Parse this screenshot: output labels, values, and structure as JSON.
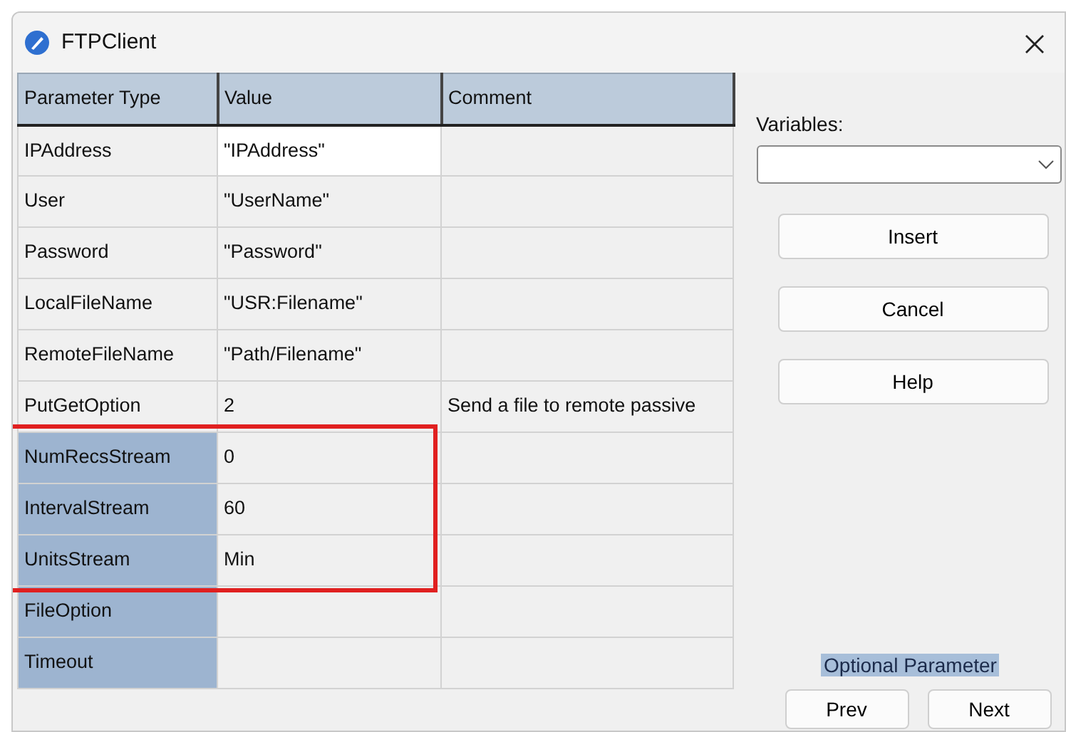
{
  "window": {
    "title": "FTPClient"
  },
  "table": {
    "columns": [
      "Parameter Type",
      "Value",
      "Comment"
    ],
    "rows": [
      {
        "parameter": "IPAddress",
        "value": "\"IPAddress\"",
        "optional": false,
        "editing": true,
        "highlighted": false
      },
      {
        "parameter": "User",
        "value": "\"UserName\"",
        "optional": false,
        "editing": false,
        "highlighted": false
      },
      {
        "parameter": "Password",
        "value": "\"Password\"",
        "optional": false,
        "editing": false,
        "highlighted": false
      },
      {
        "parameter": "LocalFileName",
        "value": "\"USR:Filename\"",
        "optional": false,
        "editing": false,
        "highlighted": false
      },
      {
        "parameter": "RemoteFileName",
        "value": "\"Path/Filename\"",
        "optional": false,
        "editing": false,
        "highlighted": false
      },
      {
        "parameter": "PutGetOption",
        "value": "2",
        "comment": "Send a file to remote passive",
        "optional": false,
        "editing": false,
        "highlighted": false
      },
      {
        "parameter": "NumRecsStream",
        "value": "0",
        "optional": true,
        "editing": false,
        "highlighted": true
      },
      {
        "parameter": "IntervalStream",
        "value": "60",
        "optional": true,
        "editing": false,
        "highlighted": true
      },
      {
        "parameter": "UnitsStream",
        "value": "Min",
        "optional": true,
        "editing": false,
        "highlighted": true
      },
      {
        "parameter": "FileOption",
        "optional": true,
        "editing": false,
        "highlighted": false
      },
      {
        "parameter": "Timeout",
        "optional": true,
        "editing": false,
        "highlighted": false
      }
    ]
  },
  "variables": {
    "label": "Variables:"
  },
  "buttons": [
    "Insert",
    "Cancel",
    "Help"
  ],
  "legend": "Optional Parameter",
  "nav_buttons": [
    "Prev",
    "Next"
  ]
}
